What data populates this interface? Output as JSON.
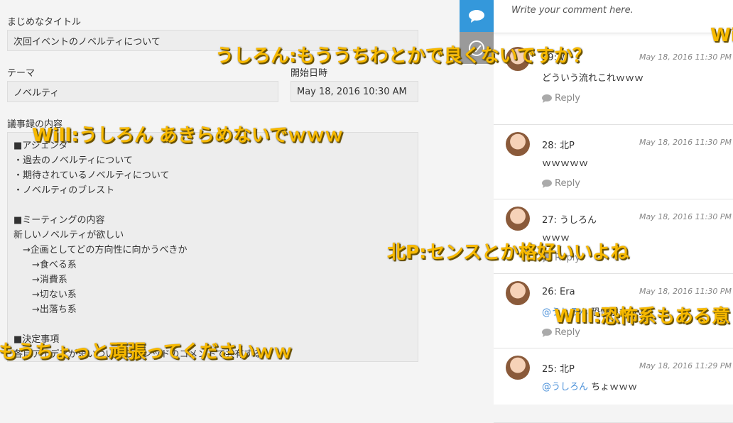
{
  "form": {
    "title_label": "まじめなタイトル",
    "title_value": "次回イベントのノベルティについて",
    "theme_label": "テーマ",
    "theme_value": "ノベルティ",
    "date_label": "開始日時",
    "date_value": "May 18, 2016 10:30 AM",
    "notes_label": "議事録の内容",
    "notes_value": "■アジェンダ\n・過去のノベルティについて\n・期待されているノベルティについて\n・ノベルティのブレスト\n\n■ミーティングの内容\n新しいノベルティが欲しい\n　→企画としてどの方向性に向かうべきか\n　　→食べる系\n　　→消費系\n　　→切ない系\n　　→出落ち系\n\n■決定事項\n各自アイデアが思いついたらスレッドのコメントで共有する"
  },
  "sidebar": {
    "icons": [
      "comment-icon",
      "check-circle-icon"
    ],
    "active_color": "#3498db"
  },
  "comments": {
    "placeholder": "Write your comment here.",
    "reply_label": "Reply",
    "items": [
      {
        "name": "29: W",
        "date": "May 18, 2016 11:30 PM",
        "mention": "",
        "text": "どういう流れこれｗｗｗ"
      },
      {
        "name": "28: 北P",
        "date": "May 18, 2016 11:30 PM",
        "mention": "",
        "text": "ｗｗｗｗｗ"
      },
      {
        "name": "27: うしろん",
        "date": "May 18, 2016 11:30 PM",
        "mention": "",
        "text": "ｗｗｗ"
      },
      {
        "name": "26: Era",
        "date": "May 18, 2016 11:30 PM",
        "mention": "@うしろん",
        "text": "恐怖系もｗｗ"
      },
      {
        "name": "25: 北P",
        "date": "May 18, 2016 11:29 PM",
        "mention": "@うしろん",
        "text": "ちょｗｗｗ"
      }
    ]
  },
  "overlay": [
    "うしろん:もううちわとかで良くないですか？",
    "Will:うしろん あきらめないでｗｗｗ",
    "北P:センスとか格好いいよね",
    "Will:恐怖系もある意",
    "もうちょっと頑張ってくださいｗｗ",
    "Wi"
  ],
  "overlay_color": "#f7b900"
}
